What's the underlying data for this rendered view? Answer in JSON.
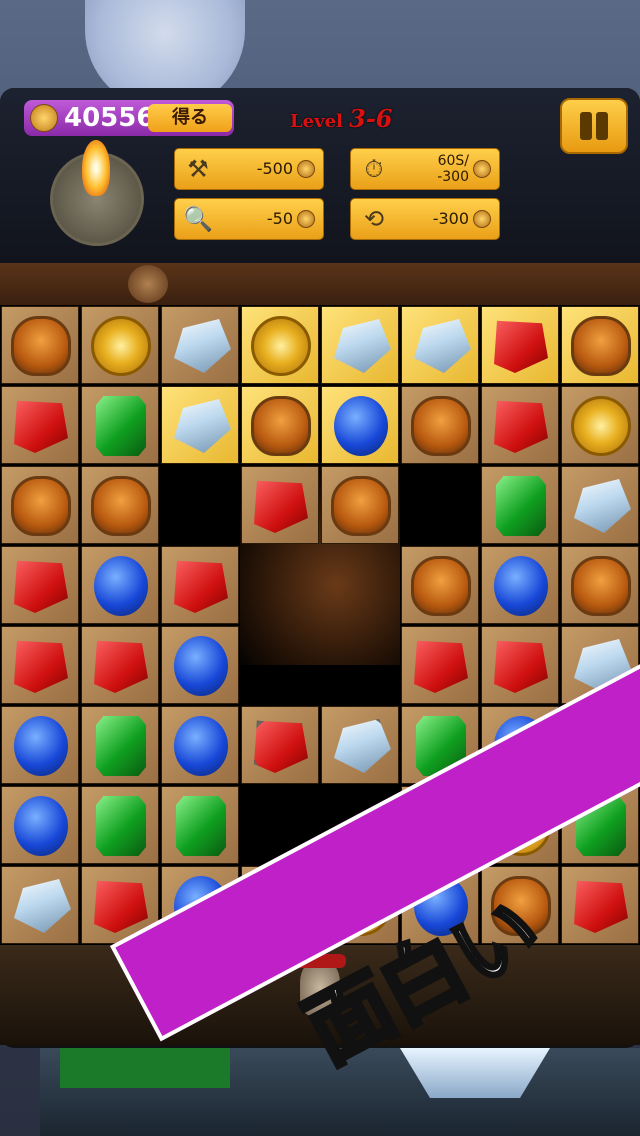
{
  "hud": {
    "coins": "40556",
    "get_label": "得る",
    "level_prefix": "Level",
    "level_value": "3-6",
    "tools": [
      {
        "icon": "hammer-icon",
        "cost": "-500"
      },
      {
        "icon": "stopwatch-icon",
        "cost": "60S/\n-300"
      },
      {
        "icon": "magnifier-icon",
        "cost": "-50"
      },
      {
        "icon": "shuffle-icon",
        "cost": "-300"
      }
    ]
  },
  "board": {
    "rows": [
      [
        "mask",
        "lion",
        "diamond",
        "lion",
        "diamond",
        "diamond",
        "red",
        "mask"
      ],
      [
        "red",
        "green",
        "diamond",
        "mask",
        "blue",
        "mask",
        "red",
        "lion"
      ],
      [
        "mask",
        "mask",
        "empty",
        "red",
        "mask",
        "empty",
        "green",
        "diamond"
      ],
      [
        "red",
        "blue",
        "red",
        "empty",
        "empty",
        "mask",
        "blue",
        "mask"
      ],
      [
        "red",
        "red",
        "blue",
        "empty",
        "empty",
        "red",
        "red",
        "diamond"
      ],
      [
        "blue",
        "green",
        "blue",
        "red",
        "diamond",
        "green",
        "blue",
        "blue"
      ],
      [
        "blue",
        "green",
        "green",
        "empty",
        "empty",
        "lion",
        "lion",
        "green"
      ],
      [
        "diamond",
        "red",
        "blue",
        "lion",
        "lion",
        "blue",
        "mask",
        "red"
      ]
    ],
    "gold_cells": [
      [
        0,
        3
      ],
      [
        0,
        4
      ],
      [
        0,
        5
      ],
      [
        0,
        6
      ],
      [
        0,
        7
      ],
      [
        1,
        2
      ],
      [
        1,
        3
      ],
      [
        1,
        4
      ]
    ],
    "chained_cells": [
      [
        5,
        3
      ],
      [
        5,
        4
      ]
    ]
  },
  "banner": {
    "text": "面白い"
  },
  "colors": {
    "accent": "#c020c8",
    "button": "#f0a018"
  }
}
